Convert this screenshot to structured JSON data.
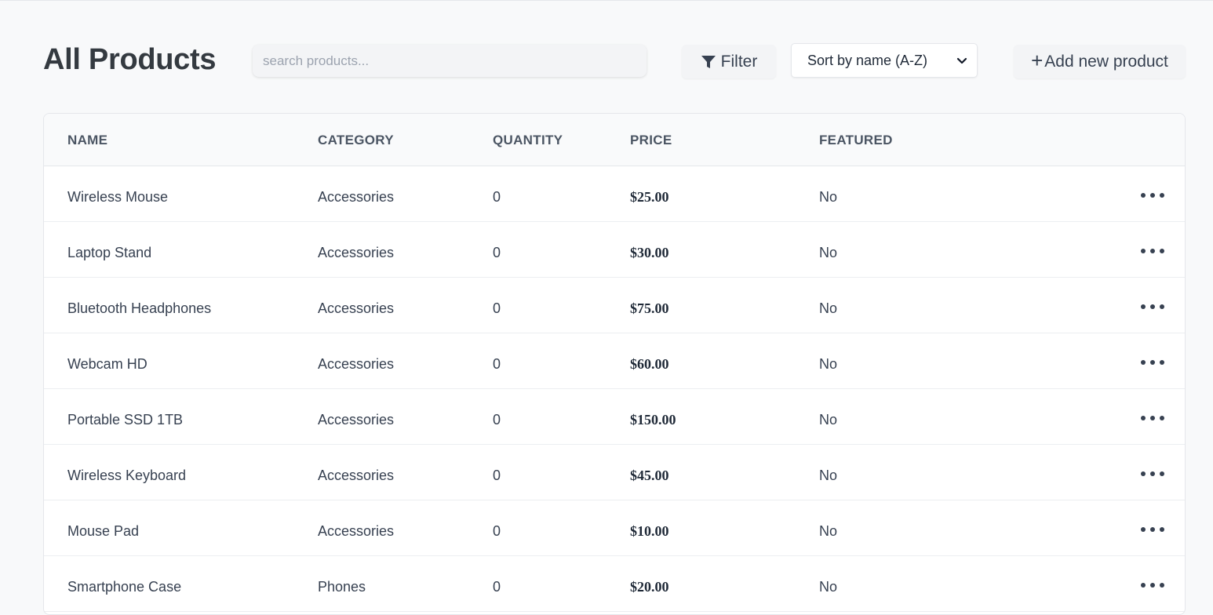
{
  "header": {
    "title": "All Products",
    "search_placeholder": "search products...",
    "filter_label": "Filter",
    "filter_icon": "funnel-icon",
    "sort_selected": "Sort by name (A-Z)",
    "add_label": "Add new product",
    "add_icon": "plus-icon"
  },
  "table": {
    "columns": [
      "NAME",
      "CATEGORY",
      "QUANTITY",
      "PRICE",
      "FEATURED"
    ],
    "rows": [
      {
        "name": "Wireless Mouse",
        "category": "Accessories",
        "quantity": "0",
        "price": "$25.00",
        "featured": "No"
      },
      {
        "name": "Laptop Stand",
        "category": "Accessories",
        "quantity": "0",
        "price": "$30.00",
        "featured": "No"
      },
      {
        "name": "Bluetooth Headphones",
        "category": "Accessories",
        "quantity": "0",
        "price": "$75.00",
        "featured": "No"
      },
      {
        "name": "Webcam HD",
        "category": "Accessories",
        "quantity": "0",
        "price": "$60.00",
        "featured": "No"
      },
      {
        "name": "Portable SSD 1TB",
        "category": "Accessories",
        "quantity": "0",
        "price": "$150.00",
        "featured": "No"
      },
      {
        "name": "Wireless Keyboard",
        "category": "Accessories",
        "quantity": "0",
        "price": "$45.00",
        "featured": "No"
      },
      {
        "name": "Mouse Pad",
        "category": "Accessories",
        "quantity": "0",
        "price": "$10.00",
        "featured": "No"
      },
      {
        "name": "Smartphone Case",
        "category": "Phones",
        "quantity": "0",
        "price": "$20.00",
        "featured": "No"
      }
    ],
    "row_action_icon": "more-horizontal-icon"
  }
}
